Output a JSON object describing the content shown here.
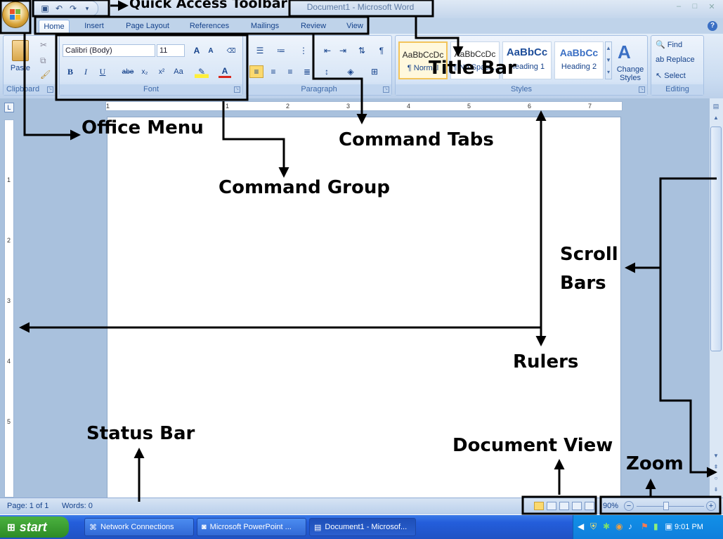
{
  "window": {
    "title": "Document1 - Microsoft Word",
    "controls": {
      "minimize": "–",
      "maximize": "□",
      "close": "✕"
    }
  },
  "quick_access": {
    "items": [
      "save-icon",
      "undo-icon",
      "redo-icon",
      "customize-icon"
    ]
  },
  "tabs": [
    {
      "label": "Home",
      "active": true
    },
    {
      "label": "Insert"
    },
    {
      "label": "Page Layout"
    },
    {
      "label": "References"
    },
    {
      "label": "Mailings"
    },
    {
      "label": "Review"
    },
    {
      "label": "View"
    }
  ],
  "ribbon": {
    "clipboard": {
      "label": "Clipboard",
      "paste": "Paste"
    },
    "font": {
      "label": "Font",
      "font_name": "Calibri (Body)",
      "font_size": "11",
      "bold": "B",
      "italic": "I",
      "underline": "U",
      "strike": "abe",
      "subscript": "x₂",
      "superscript": "x²",
      "change_case": "Aa",
      "grow": "A",
      "shrink": "A"
    },
    "paragraph": {
      "label": "Paragraph",
      "pilcrow": "¶"
    },
    "styles": {
      "label": "Styles",
      "items": [
        {
          "preview": "AaBbCcDc",
          "name": "¶ Normal",
          "selected": true
        },
        {
          "preview": "AaBbCcDc",
          "name": "¶ No Spaci..."
        },
        {
          "preview": "AaBbCc",
          "name": "Heading 1"
        },
        {
          "preview": "AaBbCc",
          "name": "Heading 2"
        }
      ],
      "change_styles": "Change Styles"
    },
    "editing": {
      "label": "Editing",
      "find": "Find",
      "replace": "Replace",
      "select": "Select"
    }
  },
  "ruler": {
    "h_numbers": [
      "1",
      "1",
      "2",
      "3",
      "4",
      "5",
      "6",
      "7"
    ],
    "v_numbers": [
      "1",
      "2",
      "3",
      "4",
      "5"
    ]
  },
  "status": {
    "page": "Page: 1 of 1",
    "words": "Words: 0",
    "zoom": "90%"
  },
  "taskbar": {
    "start": "start",
    "items": [
      {
        "label": "Network Connections"
      },
      {
        "label": "Microsoft PowerPoint ..."
      },
      {
        "label": "Document1 - Microsof...",
        "active": true
      }
    ],
    "clock": "9:01 PM"
  },
  "annotations": {
    "quick_access_toolbar": "Quick Access Toolbar",
    "title_bar": "Title Bar",
    "office_menu": "Office Menu",
    "command_tabs": "Command Tabs",
    "command_group": "Command Group",
    "scroll": "Scroll",
    "bars": "Bars",
    "rulers": "Rulers",
    "status_bar": "Status Bar",
    "document_view": "Document View",
    "zoom": "Zoom"
  }
}
